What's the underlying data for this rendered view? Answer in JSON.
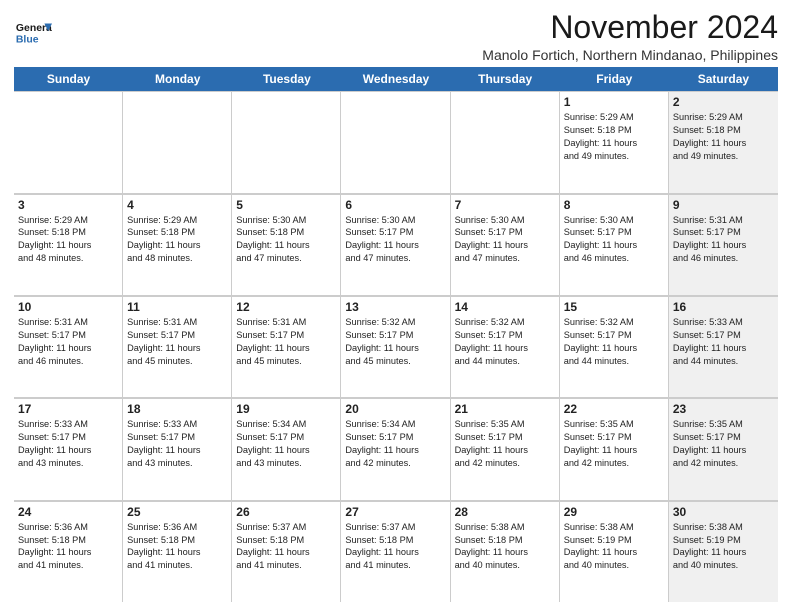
{
  "logo": {
    "line1": "General",
    "line2": "Blue"
  },
  "title": "November 2024",
  "subtitle": "Manolo Fortich, Northern Mindanao, Philippines",
  "weekdays": [
    "Sunday",
    "Monday",
    "Tuesday",
    "Wednesday",
    "Thursday",
    "Friday",
    "Saturday"
  ],
  "rows": [
    [
      {
        "day": "",
        "info": "",
        "shaded": false,
        "empty": true
      },
      {
        "day": "",
        "info": "",
        "shaded": false,
        "empty": true
      },
      {
        "day": "",
        "info": "",
        "shaded": false,
        "empty": true
      },
      {
        "day": "",
        "info": "",
        "shaded": false,
        "empty": true
      },
      {
        "day": "",
        "info": "",
        "shaded": false,
        "empty": true
      },
      {
        "day": "1",
        "info": "Sunrise: 5:29 AM\nSunset: 5:18 PM\nDaylight: 11 hours\nand 49 minutes.",
        "shaded": false
      },
      {
        "day": "2",
        "info": "Sunrise: 5:29 AM\nSunset: 5:18 PM\nDaylight: 11 hours\nand 49 minutes.",
        "shaded": true
      }
    ],
    [
      {
        "day": "3",
        "info": "Sunrise: 5:29 AM\nSunset: 5:18 PM\nDaylight: 11 hours\nand 48 minutes.",
        "shaded": false
      },
      {
        "day": "4",
        "info": "Sunrise: 5:29 AM\nSunset: 5:18 PM\nDaylight: 11 hours\nand 48 minutes.",
        "shaded": false
      },
      {
        "day": "5",
        "info": "Sunrise: 5:30 AM\nSunset: 5:18 PM\nDaylight: 11 hours\nand 47 minutes.",
        "shaded": false
      },
      {
        "day": "6",
        "info": "Sunrise: 5:30 AM\nSunset: 5:17 PM\nDaylight: 11 hours\nand 47 minutes.",
        "shaded": false
      },
      {
        "day": "7",
        "info": "Sunrise: 5:30 AM\nSunset: 5:17 PM\nDaylight: 11 hours\nand 47 minutes.",
        "shaded": false
      },
      {
        "day": "8",
        "info": "Sunrise: 5:30 AM\nSunset: 5:17 PM\nDaylight: 11 hours\nand 46 minutes.",
        "shaded": false
      },
      {
        "day": "9",
        "info": "Sunrise: 5:31 AM\nSunset: 5:17 PM\nDaylight: 11 hours\nand 46 minutes.",
        "shaded": true
      }
    ],
    [
      {
        "day": "10",
        "info": "Sunrise: 5:31 AM\nSunset: 5:17 PM\nDaylight: 11 hours\nand 46 minutes.",
        "shaded": false
      },
      {
        "day": "11",
        "info": "Sunrise: 5:31 AM\nSunset: 5:17 PM\nDaylight: 11 hours\nand 45 minutes.",
        "shaded": false
      },
      {
        "day": "12",
        "info": "Sunrise: 5:31 AM\nSunset: 5:17 PM\nDaylight: 11 hours\nand 45 minutes.",
        "shaded": false
      },
      {
        "day": "13",
        "info": "Sunrise: 5:32 AM\nSunset: 5:17 PM\nDaylight: 11 hours\nand 45 minutes.",
        "shaded": false
      },
      {
        "day": "14",
        "info": "Sunrise: 5:32 AM\nSunset: 5:17 PM\nDaylight: 11 hours\nand 44 minutes.",
        "shaded": false
      },
      {
        "day": "15",
        "info": "Sunrise: 5:32 AM\nSunset: 5:17 PM\nDaylight: 11 hours\nand 44 minutes.",
        "shaded": false
      },
      {
        "day": "16",
        "info": "Sunrise: 5:33 AM\nSunset: 5:17 PM\nDaylight: 11 hours\nand 44 minutes.",
        "shaded": true
      }
    ],
    [
      {
        "day": "17",
        "info": "Sunrise: 5:33 AM\nSunset: 5:17 PM\nDaylight: 11 hours\nand 43 minutes.",
        "shaded": false
      },
      {
        "day": "18",
        "info": "Sunrise: 5:33 AM\nSunset: 5:17 PM\nDaylight: 11 hours\nand 43 minutes.",
        "shaded": false
      },
      {
        "day": "19",
        "info": "Sunrise: 5:34 AM\nSunset: 5:17 PM\nDaylight: 11 hours\nand 43 minutes.",
        "shaded": false
      },
      {
        "day": "20",
        "info": "Sunrise: 5:34 AM\nSunset: 5:17 PM\nDaylight: 11 hours\nand 42 minutes.",
        "shaded": false
      },
      {
        "day": "21",
        "info": "Sunrise: 5:35 AM\nSunset: 5:17 PM\nDaylight: 11 hours\nand 42 minutes.",
        "shaded": false
      },
      {
        "day": "22",
        "info": "Sunrise: 5:35 AM\nSunset: 5:17 PM\nDaylight: 11 hours\nand 42 minutes.",
        "shaded": false
      },
      {
        "day": "23",
        "info": "Sunrise: 5:35 AM\nSunset: 5:17 PM\nDaylight: 11 hours\nand 42 minutes.",
        "shaded": true
      }
    ],
    [
      {
        "day": "24",
        "info": "Sunrise: 5:36 AM\nSunset: 5:18 PM\nDaylight: 11 hours\nand 41 minutes.",
        "shaded": false
      },
      {
        "day": "25",
        "info": "Sunrise: 5:36 AM\nSunset: 5:18 PM\nDaylight: 11 hours\nand 41 minutes.",
        "shaded": false
      },
      {
        "day": "26",
        "info": "Sunrise: 5:37 AM\nSunset: 5:18 PM\nDaylight: 11 hours\nand 41 minutes.",
        "shaded": false
      },
      {
        "day": "27",
        "info": "Sunrise: 5:37 AM\nSunset: 5:18 PM\nDaylight: 11 hours\nand 41 minutes.",
        "shaded": false
      },
      {
        "day": "28",
        "info": "Sunrise: 5:38 AM\nSunset: 5:18 PM\nDaylight: 11 hours\nand 40 minutes.",
        "shaded": false
      },
      {
        "day": "29",
        "info": "Sunrise: 5:38 AM\nSunset: 5:19 PM\nDaylight: 11 hours\nand 40 minutes.",
        "shaded": false
      },
      {
        "day": "30",
        "info": "Sunrise: 5:38 AM\nSunset: 5:19 PM\nDaylight: 11 hours\nand 40 minutes.",
        "shaded": true
      }
    ]
  ]
}
